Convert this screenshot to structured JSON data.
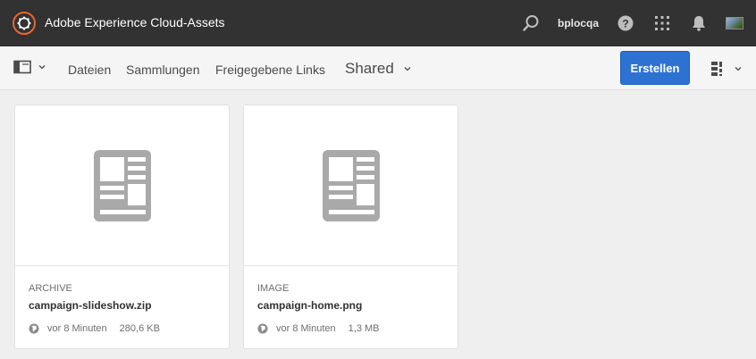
{
  "shell": {
    "app_title": "Adobe Experience Cloud-Assets",
    "user_name": "bplocqa"
  },
  "actionbar": {
    "nav": [
      "Dateien",
      "Sammlungen",
      "Freigegebene Links"
    ],
    "current": "Shared",
    "create_label": "Erstellen"
  },
  "cards": [
    {
      "type": "ARCHIVE",
      "name": "campaign-slideshow.zip",
      "modified": "vor 8 Minuten",
      "size": "280,6 KB"
    },
    {
      "type": "IMAGE",
      "name": "campaign-home.png",
      "modified": "vor 8 Minuten",
      "size": "1,3 MB"
    }
  ],
  "colors": {
    "shell": "#323232",
    "primary": "#2d72d2",
    "background": "#efefef"
  }
}
